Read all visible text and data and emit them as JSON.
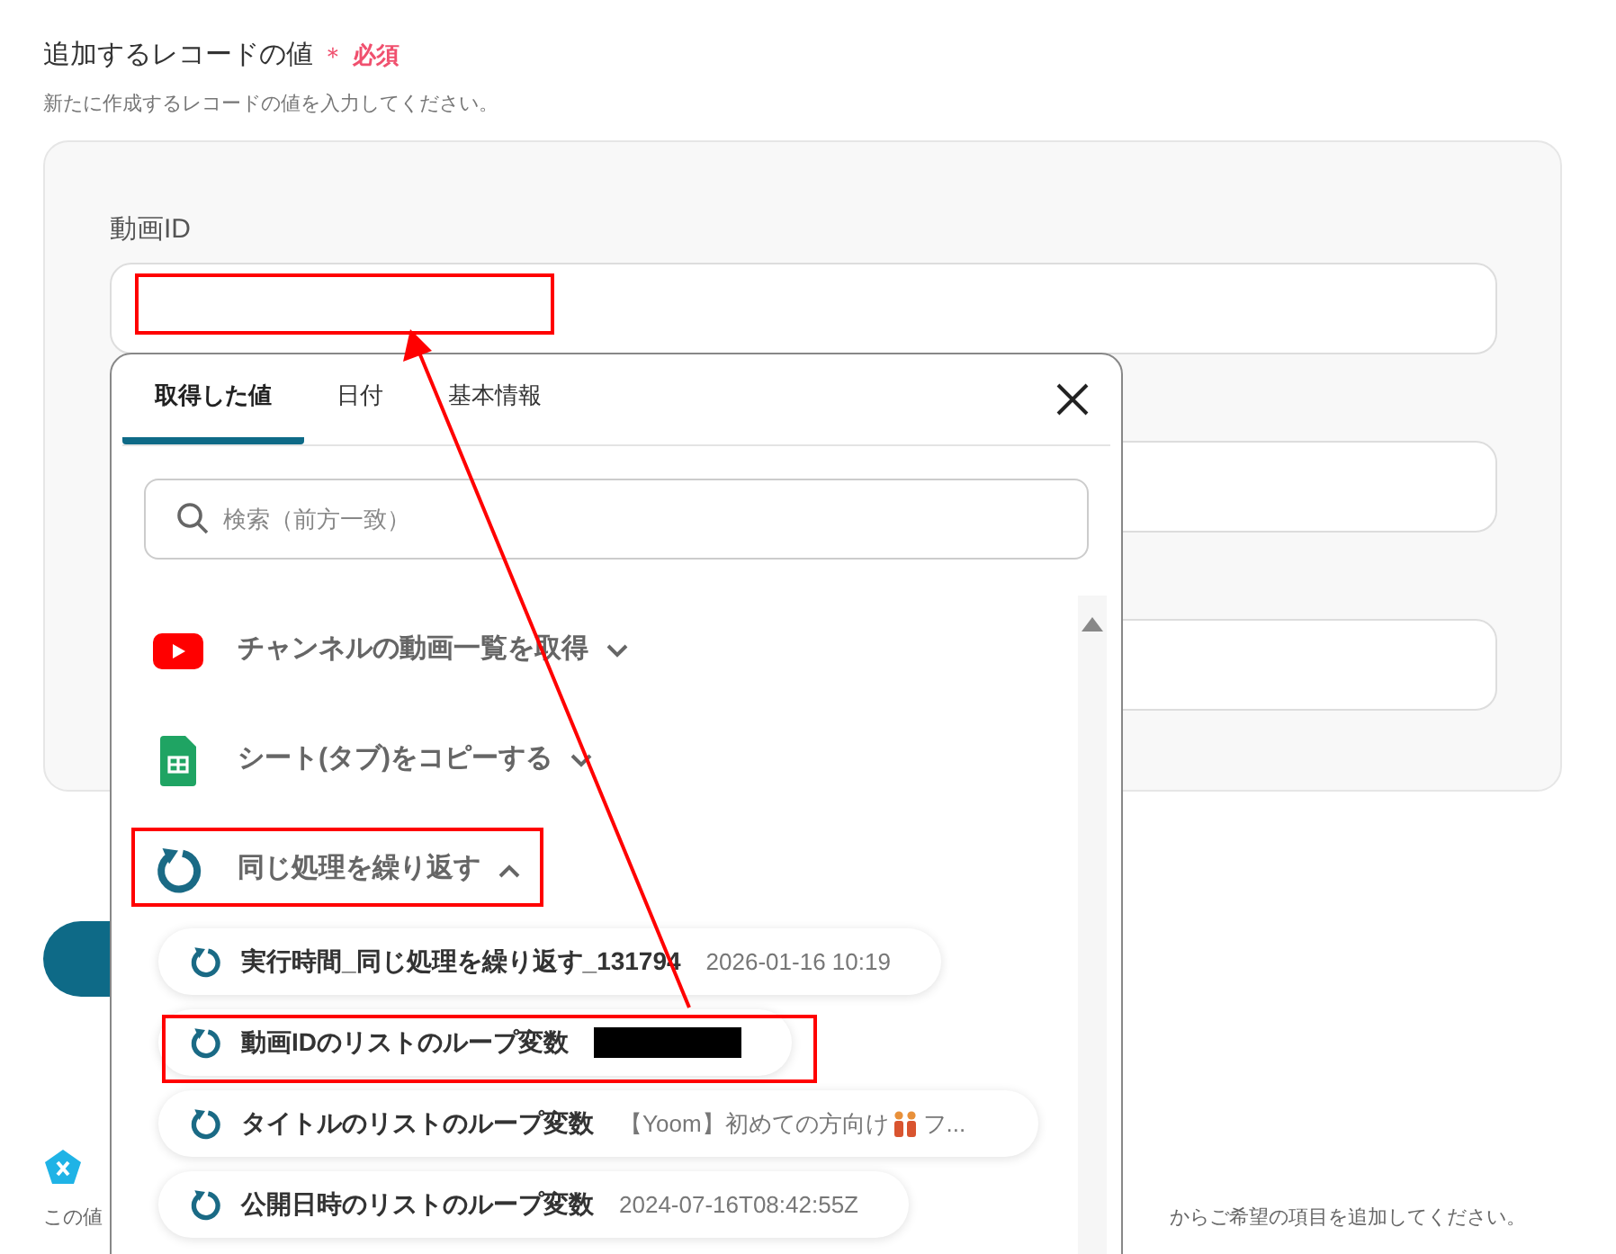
{
  "form": {
    "title": "追加するレコードの値",
    "required_mark": "＊",
    "required_label": "必須",
    "description": "新たに作成するレコードの値を入力してください。",
    "fields": [
      {
        "kind": "labeled",
        "label": "動画ID"
      },
      {
        "kind": "plain"
      },
      {
        "kind": "plain"
      }
    ]
  },
  "background": {
    "note_start": "この値",
    "note_end": "からご希望の項目を追加してください。"
  },
  "popup": {
    "tabs": [
      {
        "label": "取得した値",
        "selected": true
      },
      {
        "label": "日付",
        "selected": false
      },
      {
        "label": "基本情報",
        "selected": false
      }
    ],
    "search": {
      "placeholder": "検索（前方一致）"
    },
    "groups": [
      {
        "title": "チャンネルの動画一覧を取得",
        "expanded": false
      },
      {
        "title": "シート(タブ)をコピーする",
        "expanded": false
      },
      {
        "title": "同じ処理を繰り返す",
        "expanded": true,
        "items": [
          {
            "name": "実行時間_同じ処理を繰り返す_131794",
            "value": "2026-01-16 10:19",
            "redacted": false
          },
          {
            "name": "動画IDのリストのループ変数",
            "redacted": true
          },
          {
            "name": "タイトルのリストのループ変数",
            "value": "【Yoom】初めての方向け",
            "value_tail": "フ...",
            "redacted": false
          },
          {
            "name": "公開日時のリストのループ変数",
            "value": "2024-07-16T08:42:55Z",
            "redacted": false
          }
        ]
      }
    ]
  }
}
